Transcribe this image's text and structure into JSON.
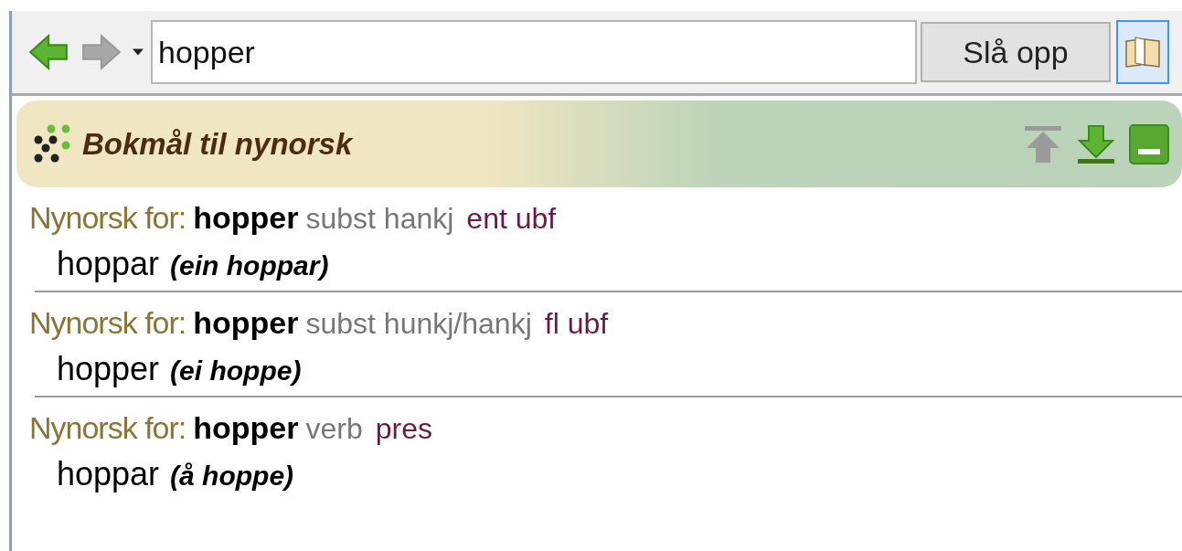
{
  "toolbar": {
    "back": {
      "disabled": false
    },
    "forward": {
      "disabled": true
    },
    "search": {
      "value": "hopper"
    },
    "lookup_button": "Slå opp",
    "book_toggle": {
      "selected": true
    }
  },
  "section": {
    "title": "Bokmål til nynorsk",
    "move_up": {
      "disabled": true
    },
    "move_down": {
      "disabled": false
    }
  },
  "entries": [
    {
      "label": "Nynorsk for:",
      "headword": "hopper",
      "grammar": "subst hankj",
      "inflection": "ent ubf",
      "translation": "hoppar",
      "example": "(ein hoppar)"
    },
    {
      "label": "Nynorsk for:",
      "headword": "hopper",
      "grammar": "subst hunkj/hankj",
      "inflection": "fl ubf",
      "translation": "hopper",
      "example": "(ei hoppe)"
    },
    {
      "label": "Nynorsk for:",
      "headword": "hopper",
      "grammar": "verb",
      "inflection": "pres",
      "translation": "hoppar",
      "example": "(å hoppe)"
    }
  ]
}
